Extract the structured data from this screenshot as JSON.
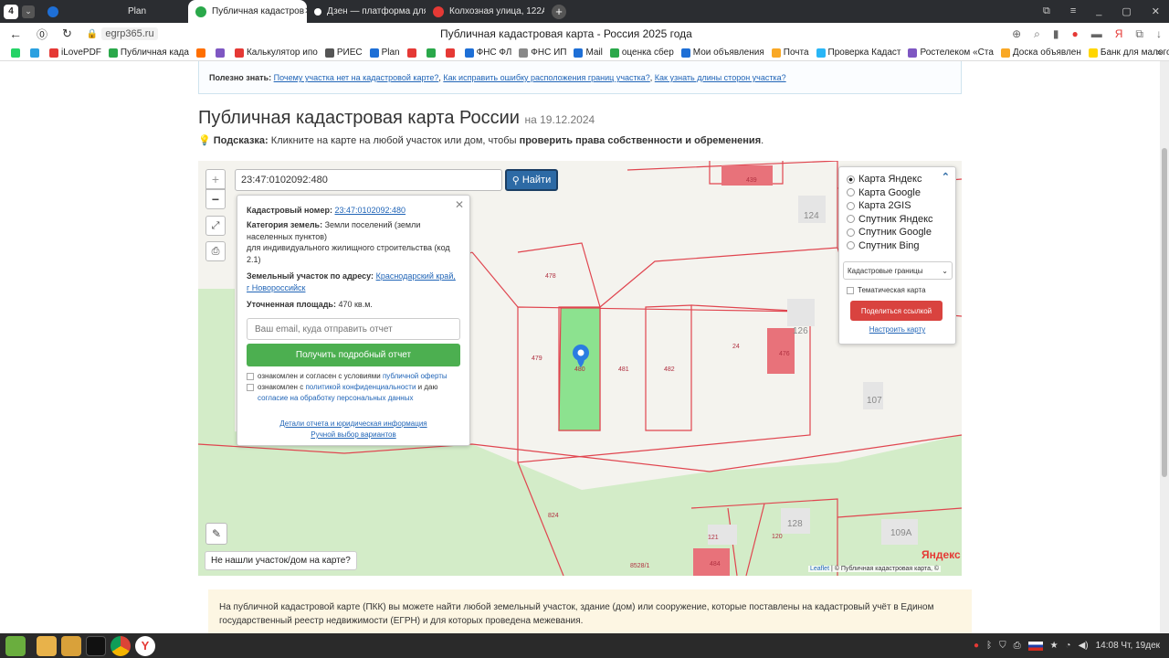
{
  "browser": {
    "tab_counter": "4",
    "tabs": [
      {
        "label": "Plan",
        "color": "#1e6fd6"
      },
      {
        "label": "Публичная кадастров",
        "color": "#2aa84a"
      },
      {
        "label": "Дзен — платформа для",
        "color": "#222"
      },
      {
        "label": "Колхозная улица, 122А",
        "color": "#e53935"
      }
    ],
    "url": "egrp365.ru",
    "page_title": "Публичная кадастровая карта - Россия 2025 года",
    "bookmarks": [
      {
        "label": "",
        "color": "#25d366"
      },
      {
        "label": "",
        "color": "#2aa0e0"
      },
      {
        "label": "iLovePDF",
        "color": "#e53935"
      },
      {
        "label": "Публичная када",
        "color": "#2aa84a"
      },
      {
        "label": "",
        "color": "#ff6f00"
      },
      {
        "label": "",
        "color": "#7e57c2"
      },
      {
        "label": "Калькулятор ипо",
        "color": "#e53935"
      },
      {
        "label": "РИЕС",
        "color": "#555"
      },
      {
        "label": "Plan",
        "color": "#1e6fd6"
      },
      {
        "label": "",
        "color": "#e53935"
      },
      {
        "label": "",
        "color": "#2aa84a"
      },
      {
        "label": "",
        "color": "#e53935"
      },
      {
        "label": "ФНС ФЛ",
        "color": "#1e6fd6"
      },
      {
        "label": "ФНС ИП",
        "color": "#888"
      },
      {
        "label": "Mail",
        "color": "#1e6fd6"
      },
      {
        "label": "оценка сбер",
        "color": "#2aa84a"
      },
      {
        "label": "Мои объявления",
        "color": "#1e6fd6"
      },
      {
        "label": "Почта",
        "color": "#f9a825"
      },
      {
        "label": "Проверка Кадаст",
        "color": "#29b6f6"
      },
      {
        "label": "Ростелеком «Ста",
        "color": "#7e57c2"
      },
      {
        "label": "Доска объявлен",
        "color": "#f9a825"
      },
      {
        "label": "Банк для малого",
        "color": "#ffd600"
      },
      {
        "label": "",
        "color": "#29b6f6"
      },
      {
        "label": "",
        "color": "#2aa84a"
      }
    ]
  },
  "info_bar": {
    "prefix": "Полезно знать:",
    "link1": "Почему участка нет на кадастровой карте?",
    "link2": "Как исправить ошибку расположения границ участка?",
    "link3": "Как узнать длины сторон участка?"
  },
  "heading": {
    "title": "Публичная кадастровая карта России",
    "date": "на 19.12.2024"
  },
  "hint": {
    "label": "Подсказка:",
    "text": "Кликните на карте на любой участок или дом, чтобы",
    "bold": "проверить права собственности и обременения",
    "end": "."
  },
  "map": {
    "search_value": "23:47:0102092:480",
    "search_button": "Найти",
    "zoom_in": "+",
    "zoom_out": "−",
    "not_found": "Не нашли участок/дом на карте?",
    "attribution_leaflet": "Leaflet",
    "attribution_rest": "| © Публичная кадастровая карта, ©",
    "yandex": "Яндекс",
    "labels": {
      "p439": "439",
      "p124": "124",
      "p478": "478",
      "p126": "126",
      "p476": "476",
      "p24": "24",
      "p479": "479",
      "p480": "480",
      "p481": "481",
      "p482": "482",
      "p107": "107",
      "p824": "824",
      "p128": "128",
      "p121": "121",
      "p120": "120",
      "p109a": "109А",
      "p484": "484",
      "p8528": "8528/1"
    },
    "colors": {
      "parcel_line": "#e0454f",
      "selected": "#8ce28f",
      "building": "#e5e5e5",
      "marker": "#2a7de1",
      "filled": "#e8727a"
    }
  },
  "popup": {
    "cadnum_label": "Кадастровый номер:",
    "cadnum": "23:47:0102092:480",
    "category_label": "Категория земель:",
    "category": "Земли поселений (земли населенных пунктов)",
    "use": "для индивидуального жилищного строительства (код 2.1)",
    "address_label": "Земельный участок по адресу:",
    "address": "Краснодарский край, г Новороссийск",
    "area_label": "Уточненная площадь:",
    "area": "470 кв.м.",
    "email_placeholder": "Ваш email, куда отправить отчет",
    "report_button": "Получить подробный отчет",
    "agree1_pre": "ознакомлен и согласен с условиями",
    "agree1_link": "публичной оферты",
    "agree2_pre": "ознакомлен с",
    "agree2_link": "политикой конфиденциальности",
    "agree2_mid": "и даю",
    "agree2_link2": "согласие на обработку персональных данных",
    "details_link": "Детали отчета и юридическая информация",
    "manual_link": "Ручной выбор вариантов"
  },
  "layers": {
    "options": [
      "Карта Яндекс",
      "Карта Google",
      "Карта 2GIS",
      "Спутник Яндекс",
      "Спутник Google",
      "Спутник Bing"
    ],
    "selected_index": 0,
    "select_value": "Кадастровые границы",
    "thematic": "Тематическая карта",
    "share_button": "Поделиться ссылкой",
    "configure_link": "Настроить карту"
  },
  "notice": {
    "text": "На публичной кадастровой карте (ПКК) вы можете найти любой земельный участок, здание (дом) или сооружение, которые поставлены на кадастровый учёт в Едином государственный реестр недвижимости (ЕГРН) и для которых проведена межевания."
  },
  "taskbar": {
    "clock": "14:08 Чт, 19дек"
  }
}
